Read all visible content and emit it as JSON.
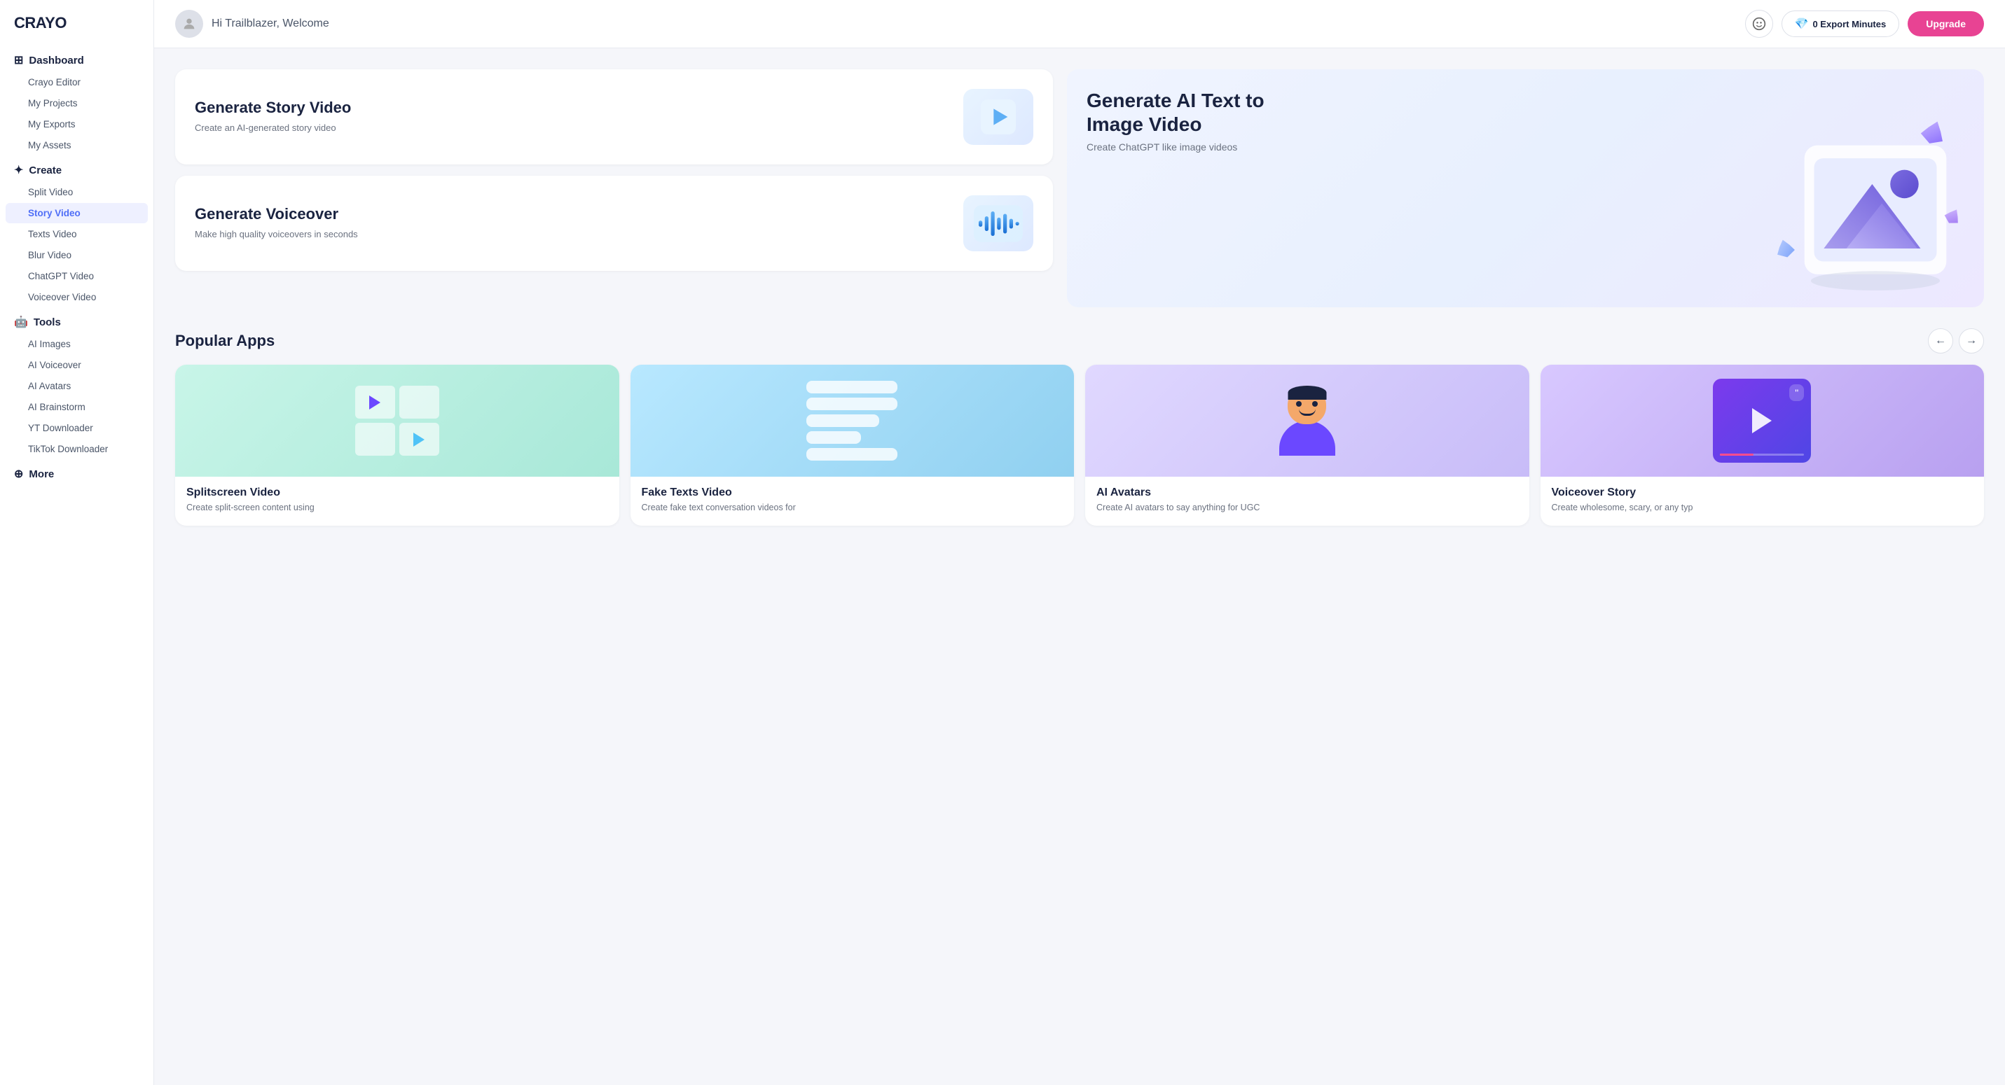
{
  "sidebar": {
    "logo": "CRAYO",
    "sections": [
      {
        "name": "Dashboard",
        "icon": "⊞",
        "items": [
          "Crayo Editor",
          "My Projects",
          "My Exports",
          "My Assets"
        ]
      },
      {
        "name": "Create",
        "icon": "✦",
        "items": [
          "Split Video",
          "Story Video",
          "Texts Video",
          "Blur Video",
          "ChatGPT Video",
          "Voiceover Video"
        ]
      },
      {
        "name": "Tools",
        "icon": "🤖",
        "items": [
          "AI Images",
          "AI Voiceover",
          "AI Avatars",
          "AI Brainstorm",
          "YT Downloader",
          "TikTok Downloader"
        ]
      },
      {
        "name": "More",
        "icon": "⊕",
        "items": []
      }
    ]
  },
  "header": {
    "welcome": "Hi Trailblazer, Welcome",
    "export_minutes": "0 Export Minutes",
    "upgrade_label": "Upgrade"
  },
  "generators": [
    {
      "title": "Generate Story Video",
      "description": "Create an AI-generated story video",
      "icon": "play"
    },
    {
      "title": "Generate Voiceover",
      "description": "Make high quality voiceovers in seconds",
      "icon": "wave"
    }
  ],
  "hero": {
    "title": "Generate AI Text to Image Video",
    "description": "Create ChatGPT like image videos"
  },
  "popular_apps": {
    "title": "Popular Apps",
    "apps": [
      {
        "name": "Splitscreen Video",
        "description": "Create split-screen content using",
        "theme": "splitscreen"
      },
      {
        "name": "Fake Texts Video",
        "description": "Create fake text conversation videos for",
        "theme": "faketexts"
      },
      {
        "name": "AI Avatars",
        "description": "Create AI avatars to say anything for UGC",
        "theme": "avatars"
      },
      {
        "name": "Voiceover Story",
        "description": "Create wholesome, scary, or any typ",
        "theme": "voiceover"
      }
    ]
  }
}
